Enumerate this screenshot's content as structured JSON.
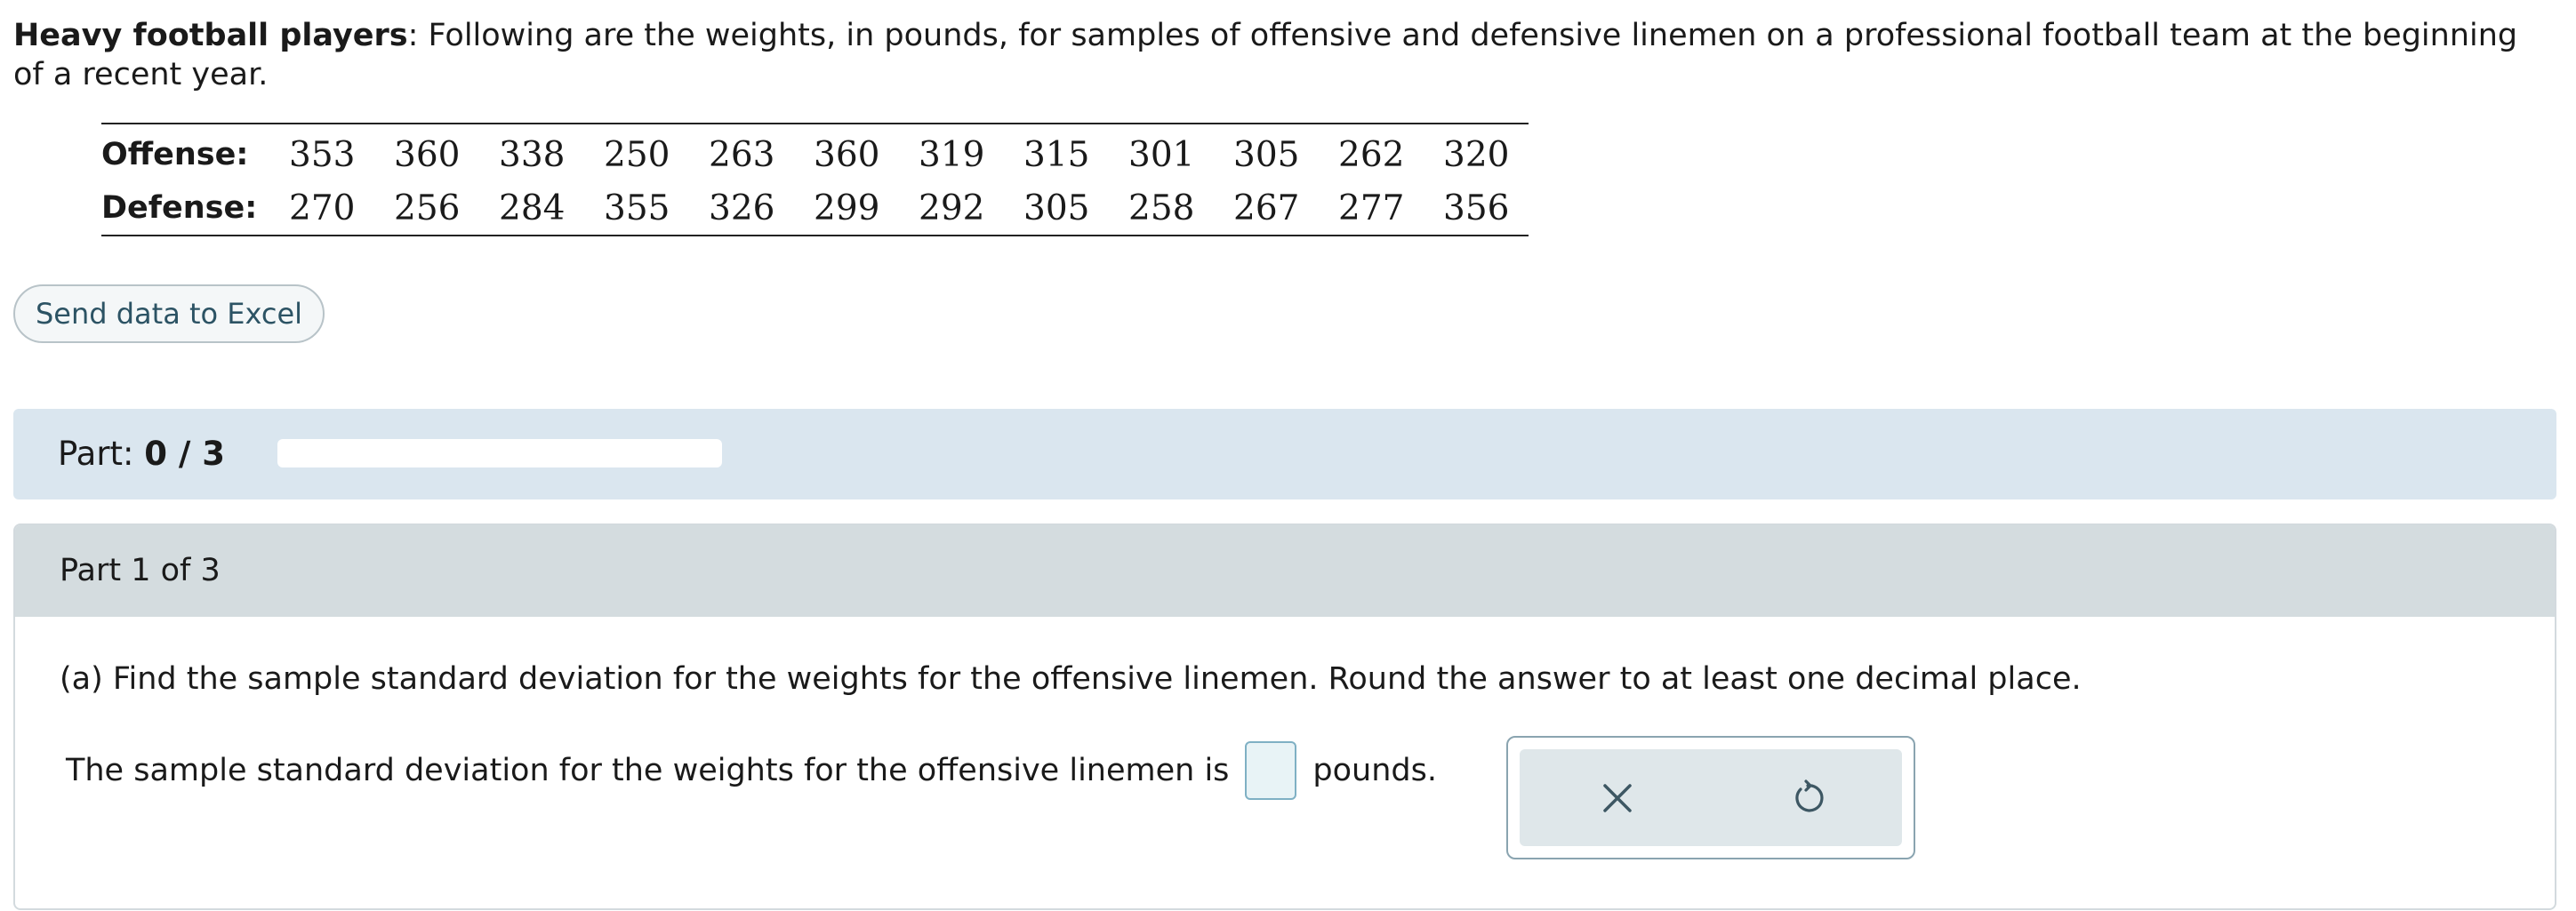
{
  "intro": {
    "title_bold": "Heavy football players",
    "text": ": Following are the weights, in pounds, for samples of offensive and defensive linemen on a professional football team at the beginning of a recent year."
  },
  "table": {
    "rows": [
      {
        "label": "Offense:",
        "values": [
          "353",
          "360",
          "338",
          "250",
          "263",
          "360",
          "319",
          "315",
          "301",
          "305",
          "262",
          "320"
        ]
      },
      {
        "label": "Defense:",
        "values": [
          "270",
          "256",
          "284",
          "355",
          "326",
          "299",
          "292",
          "305",
          "258",
          "267",
          "277",
          "356"
        ]
      }
    ]
  },
  "excel_button": {
    "label": "Send data to Excel"
  },
  "progress": {
    "label": "Part: ",
    "value_text": "0 / 3",
    "fraction": 0
  },
  "part": {
    "header": "Part 1 of 3",
    "question": "(a) Find the sample standard deviation for the weights for the offensive linemen. Round the answer to at least one decimal place.",
    "answer_prefix": "The sample standard deviation for the weights for the offensive linemen is",
    "answer_value": "",
    "answer_suffix": "pounds."
  },
  "tools": {
    "clear_icon": "close-icon",
    "undo_icon": "undo-icon"
  },
  "colors": {
    "progress_bg": "#dae6ef",
    "part_header_bg": "#d4dcdf",
    "excel_text": "#2c5364",
    "input_border": "#7fb0c4"
  }
}
